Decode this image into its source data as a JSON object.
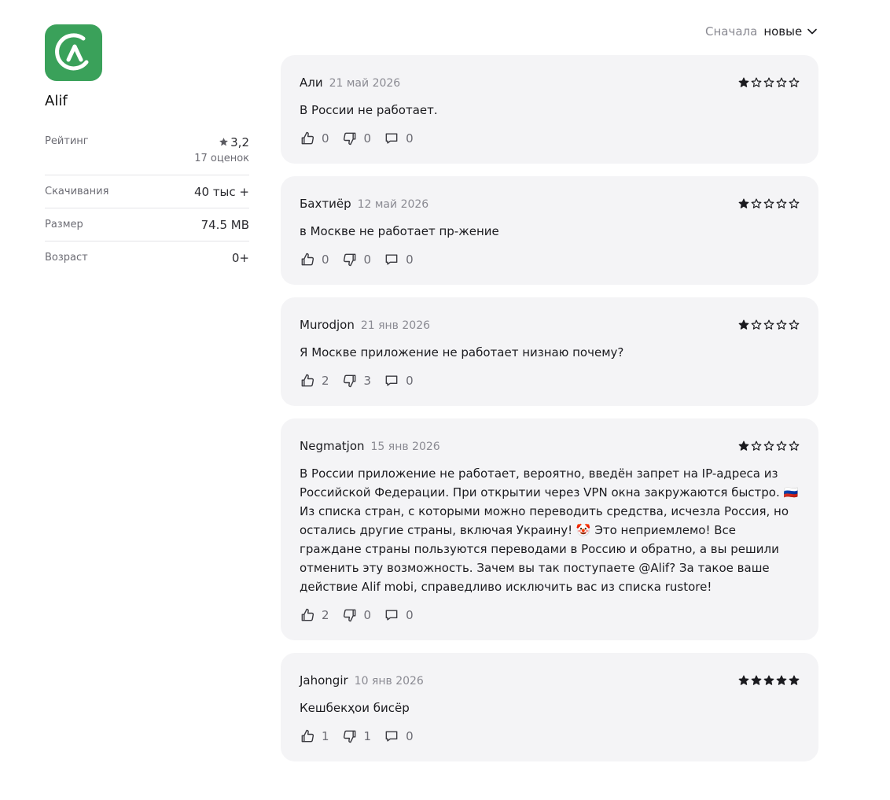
{
  "app": {
    "name": "Alif",
    "icon": "alif-logo-icon",
    "brand_color": "#3aa15a"
  },
  "info": {
    "rating_label": "Рейтинг",
    "rating_value": "3,2",
    "rating_count": "17 оценок",
    "downloads_label": "Скачивания",
    "downloads_value": "40 тыс +",
    "size_label": "Размер",
    "size_value": "74.5 MB",
    "age_label": "Возраст",
    "age_value": "0+"
  },
  "sort": {
    "label": "Сначала",
    "value": "новые"
  },
  "reviews": [
    {
      "author": "Али",
      "date": "21 май 2026",
      "rating": 1,
      "text": "В России не работает.",
      "likes": "0",
      "dislikes": "0",
      "comments": "0"
    },
    {
      "author": "Бахтиёр",
      "date": "12 май 2026",
      "rating": 1,
      "text": "в Москве не работает пр-жение",
      "likes": "0",
      "dislikes": "0",
      "comments": "0"
    },
    {
      "author": "Murodjon",
      "date": "21 янв 2026",
      "rating": 1,
      "text": "Я Москве приложение не работает низнаю почему?",
      "likes": "2",
      "dislikes": "3",
      "comments": "0"
    },
    {
      "author": "Negmatjon",
      "date": "15 янв 2026",
      "rating": 1,
      "text": "В России приложение не работает, вероятно, введён запрет на IP-адреса из Российской Федерации. При открытии через VPN окна закружаются быстро. 🇷🇺 Из списка стран, с которыми можно переводить средства, исчезла Россия, но остались другие страны, включая Украину! 🤡 Это неприемлемо! Все граждане страны пользуются переводами в Россию и обратно, а вы решили отменить эту возможность. Зачем вы так поступаете @Alif? За такое ваше действие Alif mobi, справедливо исключить вас из списка rustore!",
      "likes": "2",
      "dislikes": "0",
      "comments": "0"
    },
    {
      "author": "Jahongir",
      "date": "10 янв 2026",
      "rating": 5,
      "text": "Кешбекҳои бисёр",
      "likes": "1",
      "dislikes": "1",
      "comments": "0"
    }
  ]
}
